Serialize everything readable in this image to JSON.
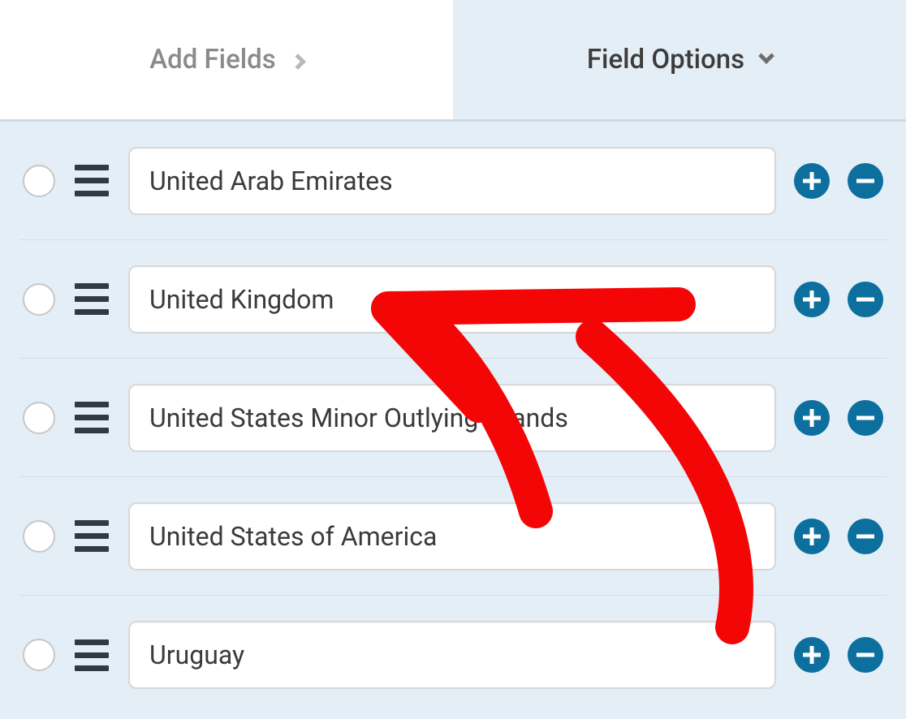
{
  "tabs": {
    "add_fields": "Add Fields",
    "field_options": "Field Options"
  },
  "options": [
    {
      "label": "United Arab Emirates"
    },
    {
      "label": "United Kingdom"
    },
    {
      "label": "United States Minor Outlying Islands"
    },
    {
      "label": "United States of America"
    },
    {
      "label": "Uruguay"
    }
  ],
  "colors": {
    "accent": "#0d6f9e",
    "panel": "#e4eef6",
    "annotation": "#f40606"
  }
}
